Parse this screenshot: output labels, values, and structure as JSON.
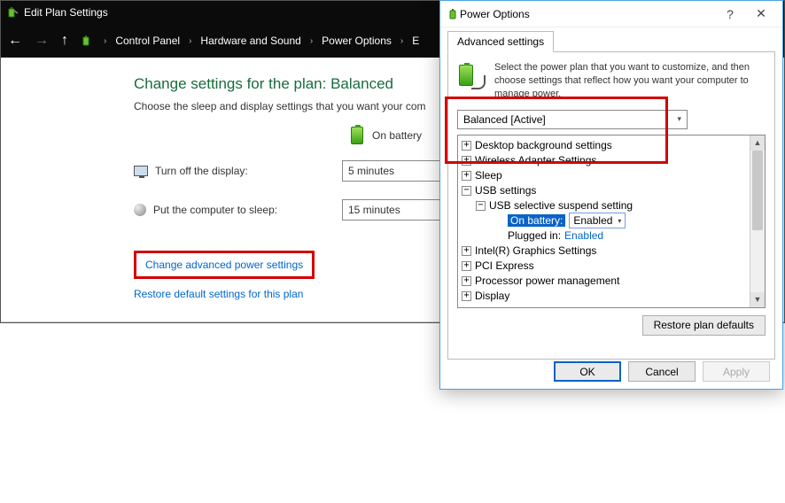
{
  "bg": {
    "title": "Edit Plan Settings",
    "breadcrumb": [
      "Control Panel",
      "Hardware and Sound",
      "Power Options",
      "E"
    ],
    "heading": "Change settings for the plan: Balanced",
    "sub": "Choose the sleep and display settings that you want your com",
    "col_on_battery": "On battery",
    "row_display": "Turn off the display:",
    "row_display_val": "5 minutes",
    "row_sleep": "Put the computer to sleep:",
    "row_sleep_val": "15 minutes",
    "link_advanced": "Change advanced power settings",
    "link_restore": "Restore default settings for this plan"
  },
  "dlg": {
    "title": "Power Options",
    "tab": "Advanced settings",
    "desc": "Select the power plan that you want to customize, and then choose settings that reflect how you want your computer to manage power.",
    "plan": "Balanced [Active]",
    "tree": {
      "desktop_bg": "Desktop background settings",
      "wireless": "Wireless Adapter Settings",
      "sleep": "Sleep",
      "usb": "USB settings",
      "usb_sel": "USB selective suspend setting",
      "on_batt_label": "On battery:",
      "on_batt_val": "Enabled",
      "plugged_label": "Plugged in:",
      "plugged_val": "Enabled",
      "intel": "Intel(R) Graphics Settings",
      "pci": "PCI Express",
      "ppm": "Processor power management",
      "display": "Display"
    },
    "restore": "Restore plan defaults",
    "ok": "OK",
    "cancel": "Cancel",
    "apply": "Apply"
  }
}
